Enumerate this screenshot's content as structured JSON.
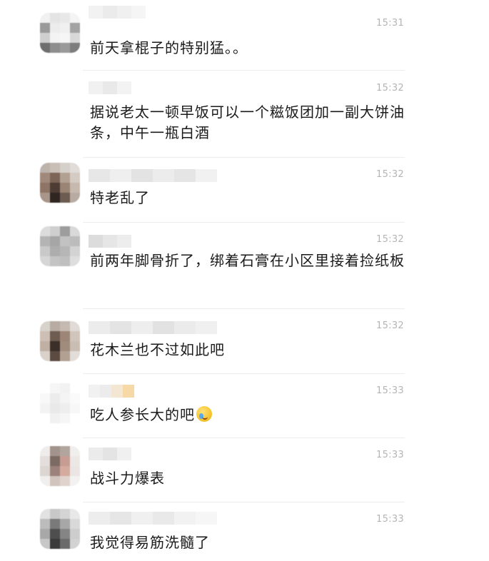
{
  "messages": [
    {
      "time": "15:31",
      "text": "前天拿棍子的特别猛。。",
      "avatar_icon": "blurred-avatar-icon",
      "has_emoji": false
    },
    {
      "time": "15:32",
      "text": "据说老太一顿早饭可以一个糍饭团加一副大饼油条，中午一瓶白酒",
      "avatar_icon": "blurred-avatar-icon",
      "has_emoji": false
    },
    {
      "time": "15:32",
      "text": "特老乱了",
      "avatar_icon": "blurred-avatar-icon",
      "has_emoji": false
    },
    {
      "time": "15:32",
      "text": "前两年脚骨折了，绑着石膏在小区里接着捡纸板",
      "avatar_icon": "blurred-avatar-icon",
      "has_emoji": false
    },
    {
      "time": "15:32",
      "text": "花木兰也不过如此吧",
      "avatar_icon": "blurred-avatar-icon",
      "has_emoji": false
    },
    {
      "time": "15:33",
      "text": "吃人参长大的吧",
      "avatar_icon": "blurred-avatar-icon",
      "has_emoji": true,
      "emoji_icon": "crying-laughing-emoji-icon"
    },
    {
      "time": "15:33",
      "text": "战斗力爆表",
      "avatar_icon": "blurred-avatar-icon",
      "has_emoji": false
    },
    {
      "time": "15:33",
      "text": "我觉得易筋洗髓了",
      "avatar_icon": "blurred-avatar-icon",
      "has_emoji": false
    }
  ],
  "colors": {
    "time_text": "#b5b5b5",
    "message_text": "#1a1a1a",
    "divider": "#ececec",
    "blur_gray_light": "#e6e6e6",
    "blur_gray_mid": "#c9c9c9",
    "blur_gray_dark": "#8c8c8c"
  }
}
